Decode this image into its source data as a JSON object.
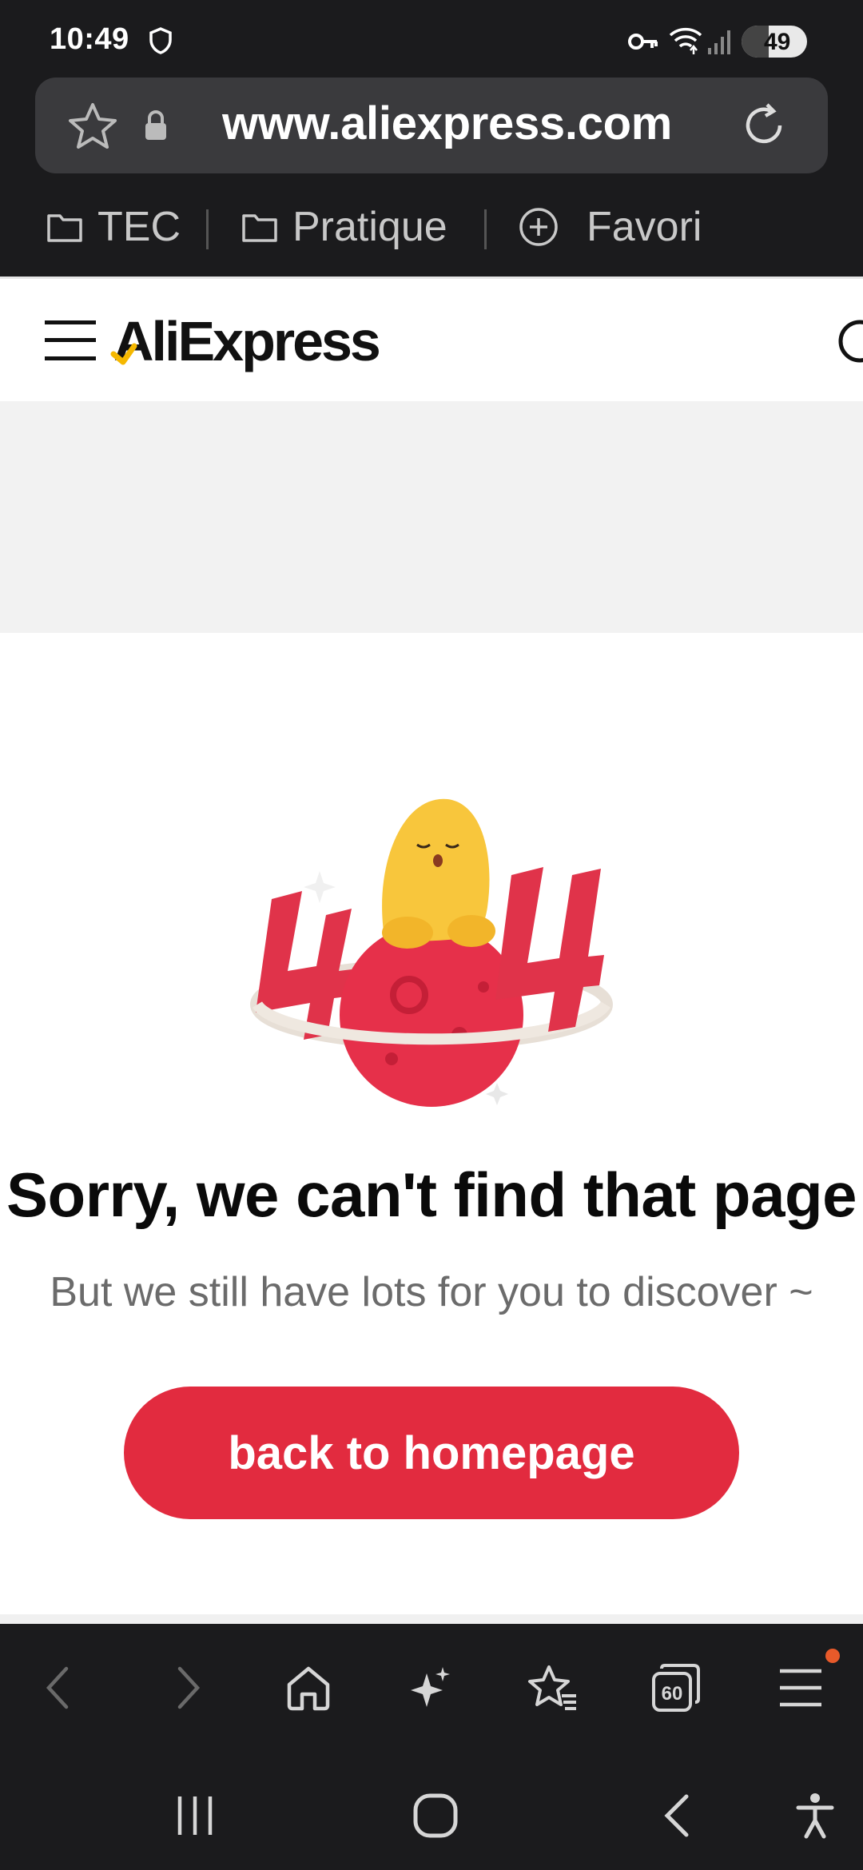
{
  "status_bar": {
    "time": "10:49",
    "battery_level": "49",
    "icons": [
      "shield-icon",
      "vpn-key-icon",
      "wifi-icon",
      "signal-icon",
      "battery-icon"
    ]
  },
  "browser": {
    "url": "www.aliexpress.com",
    "bookmarks": [
      {
        "label": "TEC",
        "icon": "folder-icon"
      },
      {
        "label": "Pratique",
        "icon": "folder-icon"
      },
      {
        "label": "Favori",
        "icon": "add-circle-icon"
      }
    ],
    "toolbar": {
      "icons": [
        "back-icon",
        "forward-icon",
        "home-icon",
        "sparkle-icon",
        "bookmarks-icon",
        "tabs-icon",
        "menu-icon"
      ],
      "tab_count": "60"
    },
    "system_nav": [
      "recents-icon",
      "home-icon",
      "back-icon",
      "accessibility-icon"
    ]
  },
  "site": {
    "logo": "AliExpress"
  },
  "error": {
    "title": "Sorry, we can't find that page",
    "subtitle": "But we still have lots for you to discover ~",
    "button": "back to homepage"
  },
  "colors": {
    "accent": "#e22b3f",
    "browser_dark": "#1b1b1d",
    "notification_dot": "#e85a2a"
  }
}
